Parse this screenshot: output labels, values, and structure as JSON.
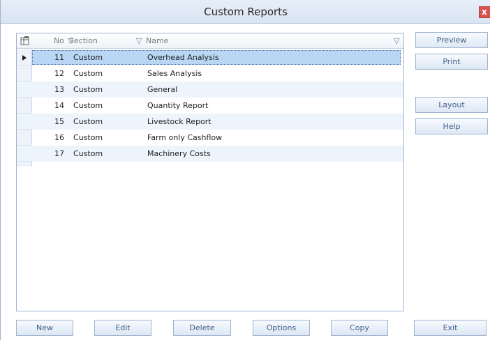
{
  "window": {
    "title": "Custom Reports",
    "close_label": "x"
  },
  "grid": {
    "headers": {
      "no": "No",
      "section": "Section",
      "name": "Name"
    },
    "rows": [
      {
        "no": "11",
        "section": "Custom",
        "name": "Overhead Analysis",
        "selected": true
      },
      {
        "no": "12",
        "section": "Custom",
        "name": "Sales Analysis"
      },
      {
        "no": "13",
        "section": "Custom",
        "name": "General"
      },
      {
        "no": "14",
        "section": "Custom",
        "name": "Quantity Report"
      },
      {
        "no": "15",
        "section": "Custom",
        "name": "Livestock Report"
      },
      {
        "no": "16",
        "section": "Custom",
        "name": "Farm only Cashflow"
      },
      {
        "no": "17",
        "section": "Custom",
        "name": "Machinery Costs"
      }
    ]
  },
  "side_buttons": {
    "preview": "Preview",
    "print": "Print",
    "layout": "Layout",
    "help": "Help"
  },
  "bottom_buttons": {
    "new": "New",
    "edit": "Edit",
    "delete": "Delete",
    "options": "Options",
    "copy": "Copy",
    "exit": "Exit"
  }
}
